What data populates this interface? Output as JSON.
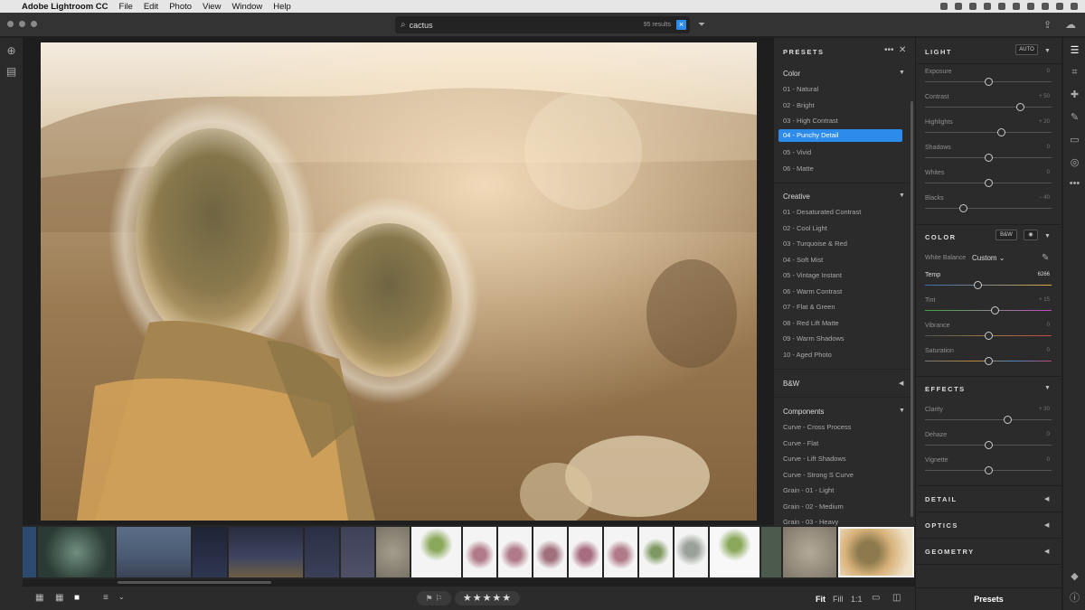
{
  "menubar": {
    "app_name": "Adobe Lightroom CC",
    "items": [
      "File",
      "Edit",
      "Photo",
      "View",
      "Window",
      "Help"
    ]
  },
  "search": {
    "query": "cactus",
    "results": "95 results"
  },
  "presets": {
    "title": "PRESETS",
    "groups": [
      {
        "name": "Color",
        "items": [
          "01 - Natural",
          "02 - Bright",
          "03 - High Contrast",
          "04 - Punchy Detail",
          "05 - Vivid",
          "06 - Matte"
        ]
      },
      {
        "name": "Creative",
        "items": [
          "01 - Desaturated Contrast",
          "02 - Cool Light",
          "03 - Turquoise & Red",
          "04 - Soft Mist",
          "05 - Vintage Instant",
          "06 - Warm Contrast",
          "07 - Flat & Green",
          "08 - Red Lift Matte",
          "09 - Warm Shadows",
          "10 - Aged Photo"
        ]
      },
      {
        "name": "B&W",
        "items": []
      },
      {
        "name": "Components",
        "items": [
          "Curve - Cross Process",
          "Curve - Flat",
          "Curve - Lift Shadows",
          "Curve - Strong S Curve",
          "Grain - 01 - Light",
          "Grain - 02 - Medium",
          "Grain - 03 - Heavy"
        ]
      }
    ],
    "selected": "04 - Punchy Detail"
  },
  "edit": {
    "light": {
      "title": "LIGHT",
      "auto_label": "AUTO",
      "sliders": [
        {
          "label": "Exposure",
          "value": "0",
          "pos": 0.5
        },
        {
          "label": "Contrast",
          "value": "+ 50",
          "pos": 0.75
        },
        {
          "label": "Highlights",
          "value": "+ 20",
          "pos": 0.6
        },
        {
          "label": "Shadows",
          "value": "0",
          "pos": 0.5
        },
        {
          "label": "Whites",
          "value": "0",
          "pos": 0.5
        },
        {
          "label": "Blacks",
          "value": "− 40",
          "pos": 0.3
        }
      ]
    },
    "color": {
      "title": "COLOR",
      "bw_label": "B&W",
      "white_balance_label": "White Balance",
      "white_balance_value": "Custom",
      "sliders": [
        {
          "label": "Temp",
          "value": "6266",
          "pos": 0.42
        },
        {
          "label": "Tint",
          "value": "+ 15",
          "pos": 0.55
        },
        {
          "label": "Vibrance",
          "value": "0",
          "pos": 0.5
        },
        {
          "label": "Saturation",
          "value": "0",
          "pos": 0.5
        }
      ]
    },
    "effects": {
      "title": "EFFECTS",
      "sliders": [
        {
          "label": "Clarity",
          "value": "+ 30",
          "pos": 0.65
        },
        {
          "label": "Dehaze",
          "value": "0",
          "pos": 0.5
        },
        {
          "label": "Vignette",
          "value": "0",
          "pos": 0.5
        }
      ]
    },
    "detail_title": "DETAIL",
    "optics_title": "OPTICS",
    "geometry_title": "GEOMETRY"
  },
  "bottombar": {
    "zoom_fit": "Fit",
    "zoom_fill": "Fill",
    "zoom_1to1": "1:1",
    "stars": "★★★★★"
  },
  "presets_button": "Presets"
}
